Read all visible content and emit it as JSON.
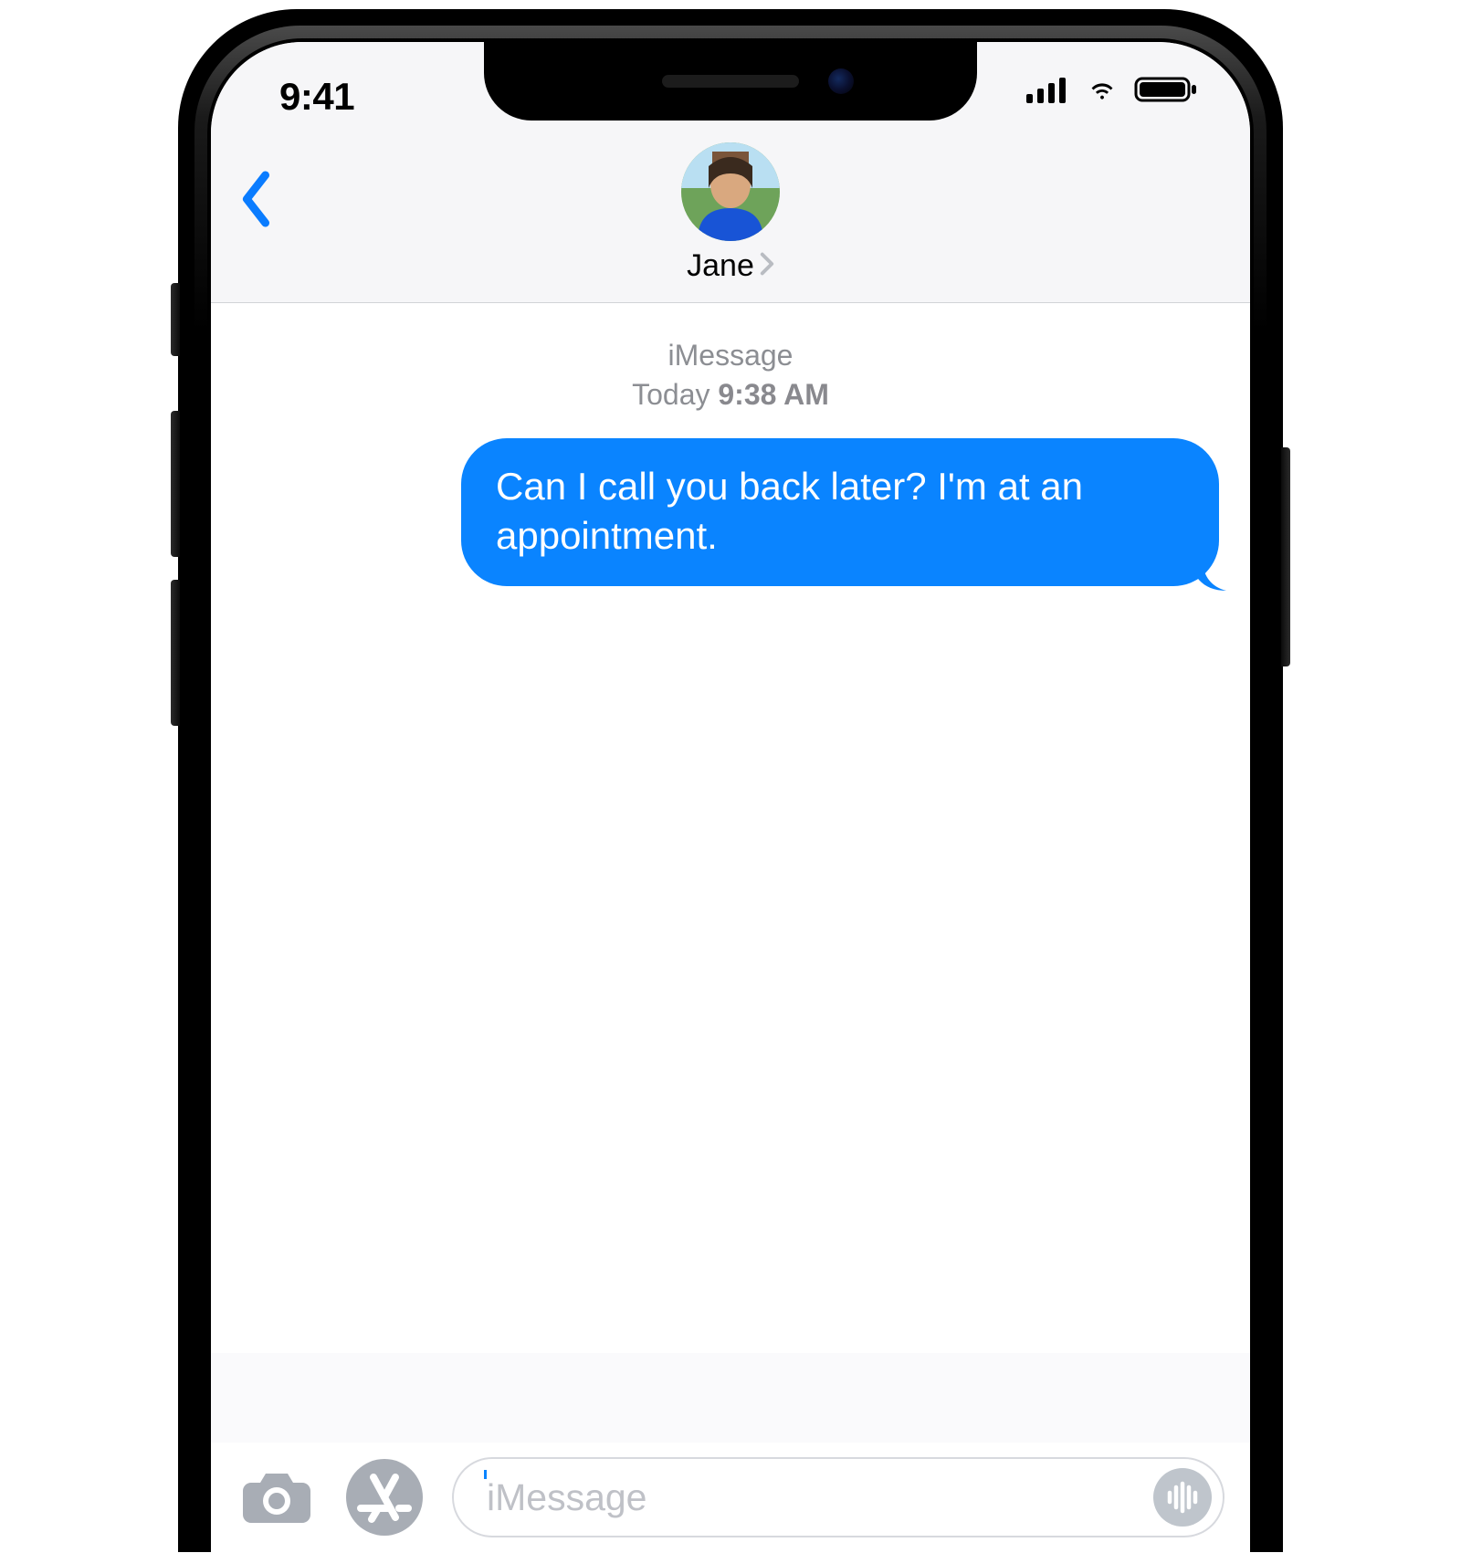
{
  "status": {
    "time": "9:41"
  },
  "header": {
    "contact_name": "Jane"
  },
  "thread": {
    "service_label": "iMessage",
    "day_label": "Today",
    "time_label": "9:38 AM",
    "messages": [
      {
        "text": "Can I call you back later? I'm at an appointment.",
        "direction": "outgoing"
      }
    ]
  },
  "input": {
    "placeholder": "iMessage"
  }
}
